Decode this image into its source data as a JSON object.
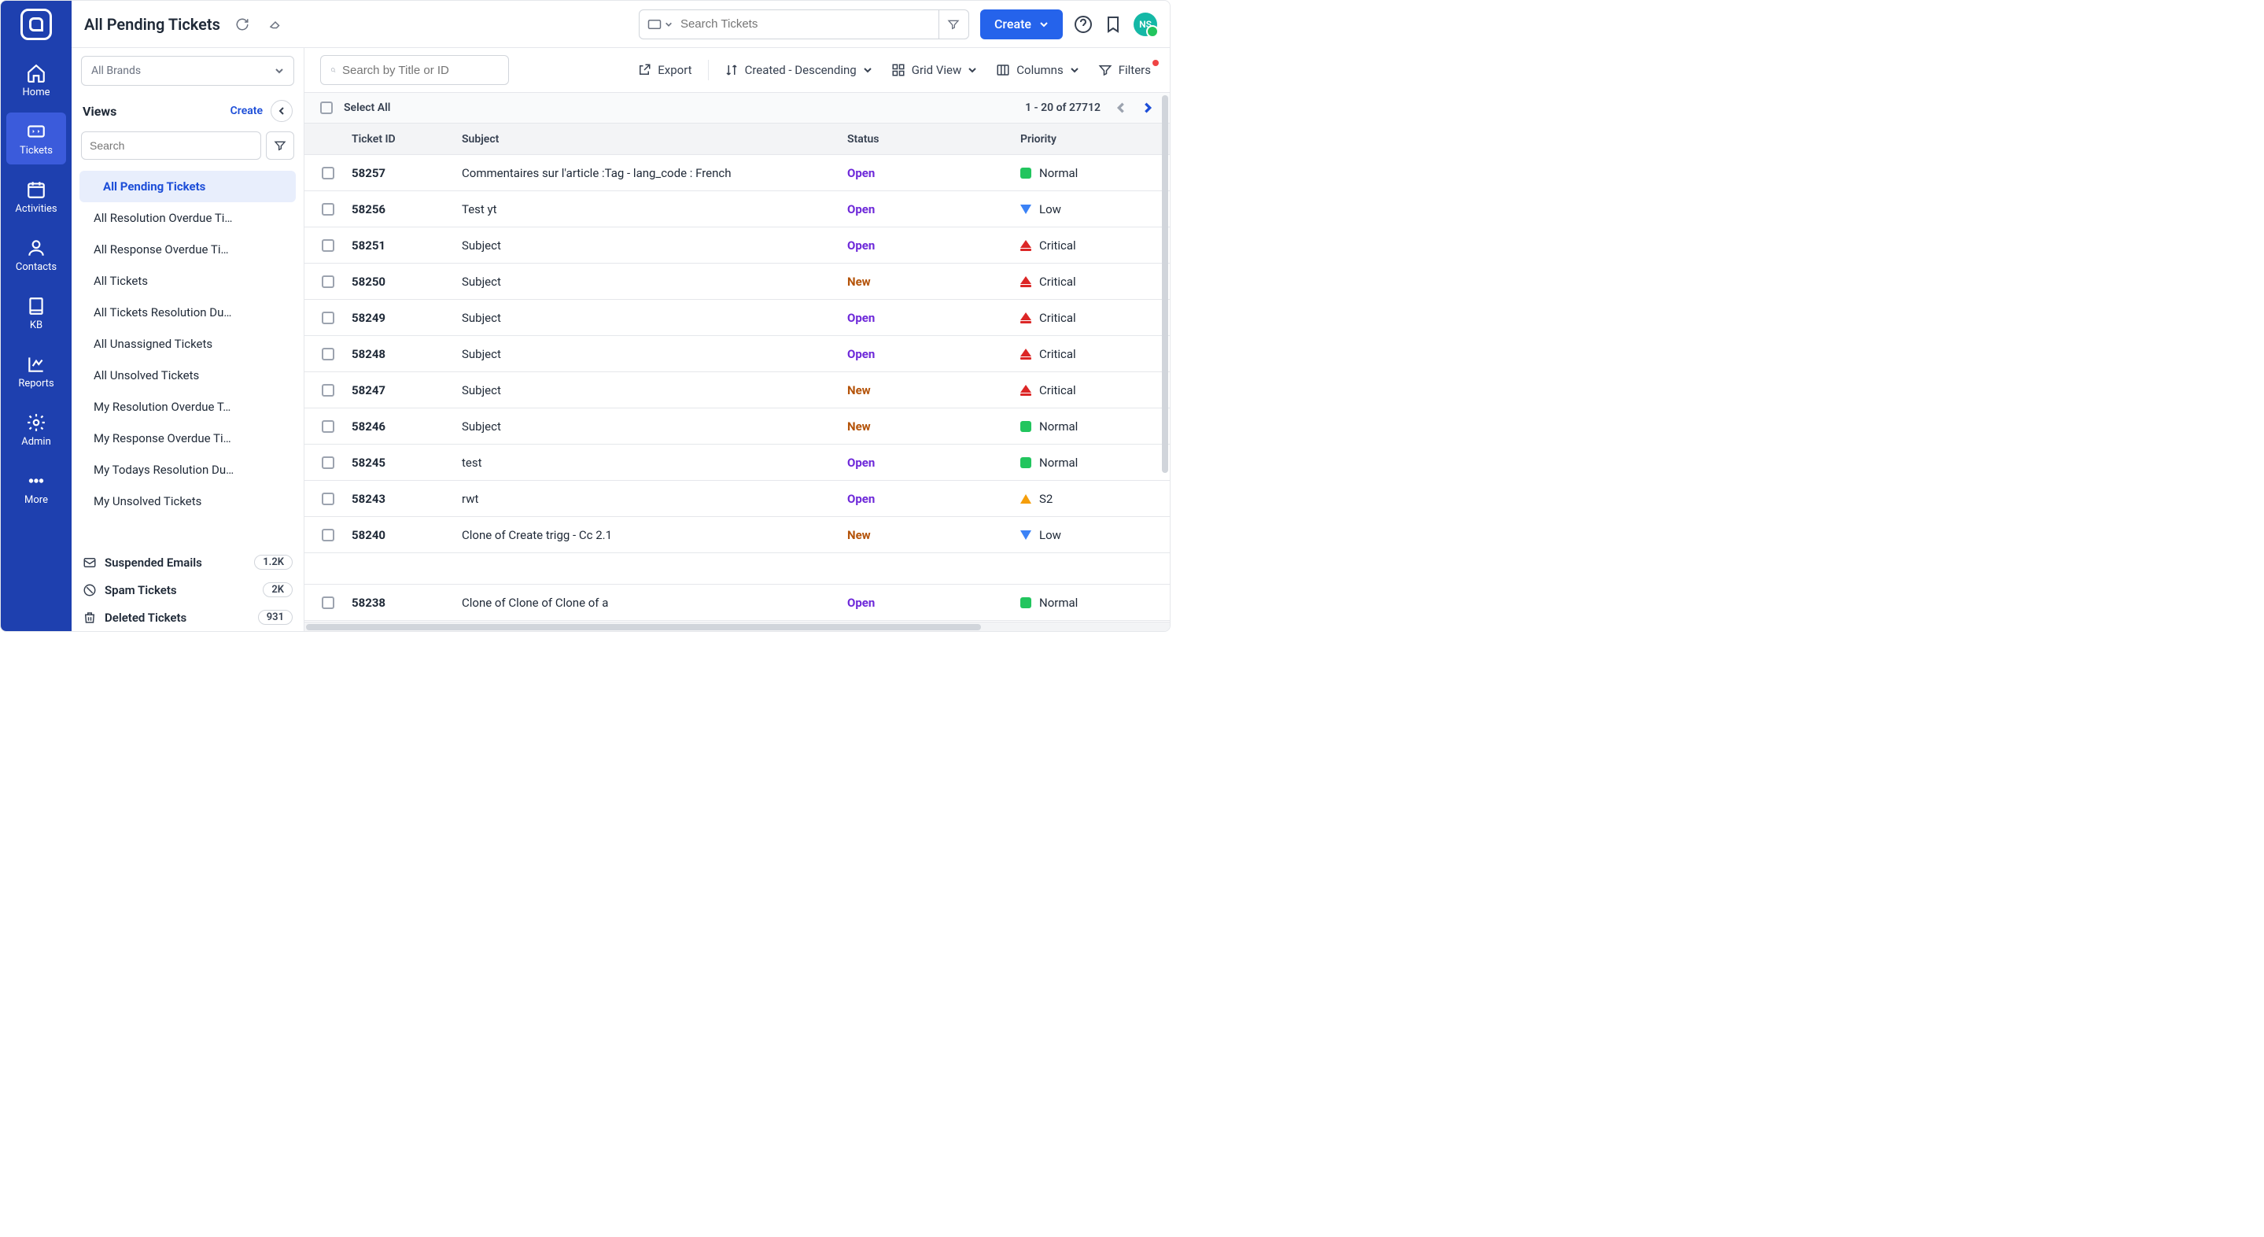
{
  "nav": {
    "items": [
      {
        "label": "Home"
      },
      {
        "label": "Tickets"
      },
      {
        "label": "Activities"
      },
      {
        "label": "Contacts"
      },
      {
        "label": "KB"
      },
      {
        "label": "Reports"
      },
      {
        "label": "Admin"
      },
      {
        "label": "More"
      }
    ]
  },
  "header": {
    "title": "All Pending Tickets",
    "search_placeholder": "Search Tickets",
    "create_label": "Create",
    "avatar_initials": "NS"
  },
  "views": {
    "brands_label": "All Brands",
    "heading": "Views",
    "create_label": "Create",
    "search_placeholder": "Search",
    "items": [
      "All Pending Tickets",
      "All Resolution Overdue Ti…",
      "All Response Overdue Ti…",
      "All Tickets",
      "All Tickets Resolution Du…",
      "All Unassigned Tickets",
      "All Unsolved Tickets",
      "My Resolution Overdue T…",
      "My Response Overdue Ti…",
      "My Todays Resolution Du…",
      "My Unsolved Tickets"
    ],
    "folders": [
      {
        "label": "Suspended Emails",
        "count": "1.2K"
      },
      {
        "label": "Spam Tickets",
        "count": "2K"
      },
      {
        "label": "Deleted Tickets",
        "count": "931"
      }
    ]
  },
  "toolbar": {
    "search_placeholder": "Search by Title or ID",
    "export_label": "Export",
    "sort_label": "Created - Descending",
    "view_label": "Grid View",
    "columns_label": "Columns",
    "filters_label": "Filters"
  },
  "selectall": {
    "label": "Select All",
    "range": "1 - 20 of 27712"
  },
  "table": {
    "headers": {
      "id": "Ticket ID",
      "subject": "Subject",
      "status": "Status",
      "priority": "Priority"
    },
    "rows": [
      {
        "id": "58257",
        "subject": "Commentaires sur l'article :Tag - lang_code : French",
        "status": "Open",
        "priority": "Normal"
      },
      {
        "id": "58256",
        "subject": "Test yt",
        "status": "Open",
        "priority": "Low"
      },
      {
        "id": "58251",
        "subject": "Subject",
        "status": "Open",
        "priority": "Critical"
      },
      {
        "id": "58250",
        "subject": "Subject",
        "status": "New",
        "priority": "Critical"
      },
      {
        "id": "58249",
        "subject": "Subject",
        "status": "Open",
        "priority": "Critical"
      },
      {
        "id": "58248",
        "subject": "Subject",
        "status": "Open",
        "priority": "Critical"
      },
      {
        "id": "58247",
        "subject": "Subject",
        "status": "New",
        "priority": "Critical"
      },
      {
        "id": "58246",
        "subject": "Subject",
        "status": "New",
        "priority": "Normal"
      },
      {
        "id": "58245",
        "subject": "test",
        "status": "Open",
        "priority": "Normal"
      },
      {
        "id": "58243",
        "subject": "rwt",
        "status": "Open",
        "priority": "S2"
      },
      {
        "id": "58240",
        "subject": "Clone of Create trigg - Cc 2.1",
        "status": "New",
        "priority": "Low"
      },
      {
        "id": "58238",
        "subject": "Clone of Clone of Clone of a",
        "status": "Open",
        "priority": "Normal"
      }
    ]
  }
}
